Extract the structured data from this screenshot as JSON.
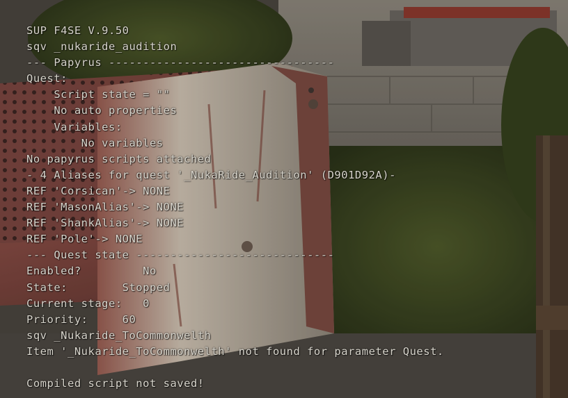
{
  "console": {
    "lines": [
      "SUP F4SE V.9.50",
      "sqv _nukaride_audition",
      "--- Papyrus ---------------------------------",
      "Quest:",
      "    Script state = \"\"",
      "    No auto properties",
      "    Variables:",
      "        No variables",
      "No papyrus scripts attached",
      "- 4 Aliases for quest '_NukaRide_Audition' (D901D92A)-",
      "REF 'Corsican'-> NONE",
      "REF 'MasonAlias'-> NONE",
      "REF 'ShankAlias'-> NONE",
      "REF 'Pole'-> NONE",
      "--- Quest state -----------------------------",
      "Enabled?         No",
      "State:        Stopped",
      "Current stage:   0",
      "Priority:     60",
      "sqv _Nukaride_ToCommonwelth",
      "Item '_Nukaride_ToCommonwelth' not found for parameter Quest.",
      "",
      "Compiled script not saved!"
    ]
  }
}
